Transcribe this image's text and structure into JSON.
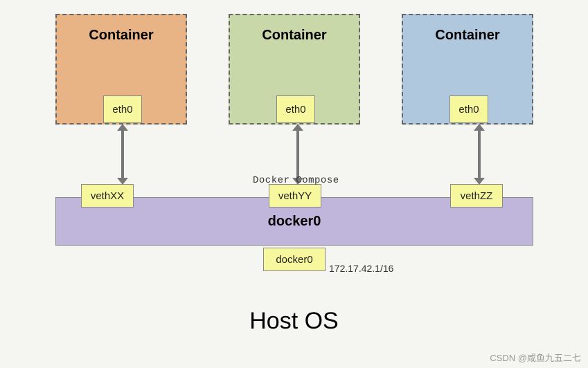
{
  "containers": [
    {
      "title": "Container",
      "iface": "eth0"
    },
    {
      "title": "Container",
      "iface": "eth0"
    },
    {
      "title": "Container",
      "iface": "eth0"
    }
  ],
  "veth": {
    "xx": "vethXX",
    "yy": "vethYY",
    "zz": "vethZZ"
  },
  "bridge": {
    "bar_label": "docker0",
    "box_label": "docker0",
    "ip": "172.17.42.1/16"
  },
  "compose_label": "Docker Compose",
  "host_label": "Host OS",
  "watermark": "CSDN @咸鱼九五二七"
}
